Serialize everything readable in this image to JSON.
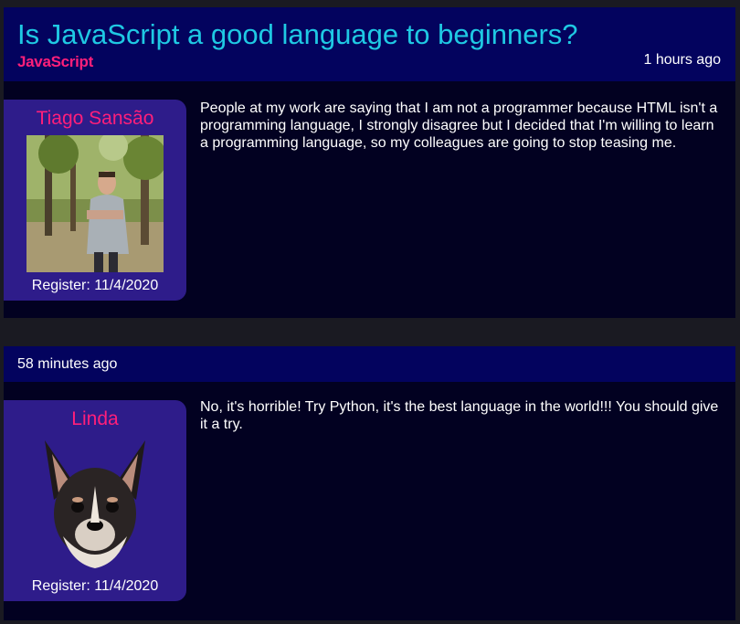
{
  "topic": {
    "title": "Is JavaScript a good language to beginners?",
    "category": "JavaScript",
    "time": "1 hours ago",
    "author": {
      "name": "Tiago Sansão",
      "register": "Register: 11/4/2020",
      "avatar_icon": "person-photo"
    },
    "body": "People at my work are saying that I am not a programmer because HTML isn't a programming language, I strongly disagree but I decided that I'm willing to learn a programming language, so my colleagues are going to stop teasing me."
  },
  "reply": {
    "time": "58 minutes ago",
    "author": {
      "name": "Linda",
      "register": "Register: 11/4/2020",
      "avatar_icon": "dog-photo"
    },
    "body": "No, it's horrible! Try Python, it's the best language in the world!!! You should give it a try."
  },
  "colors": {
    "header_bg": "#03035e",
    "card_bg": "#2e1c8a",
    "title": "#1fc9e3",
    "accent": "#ff1f7a"
  }
}
